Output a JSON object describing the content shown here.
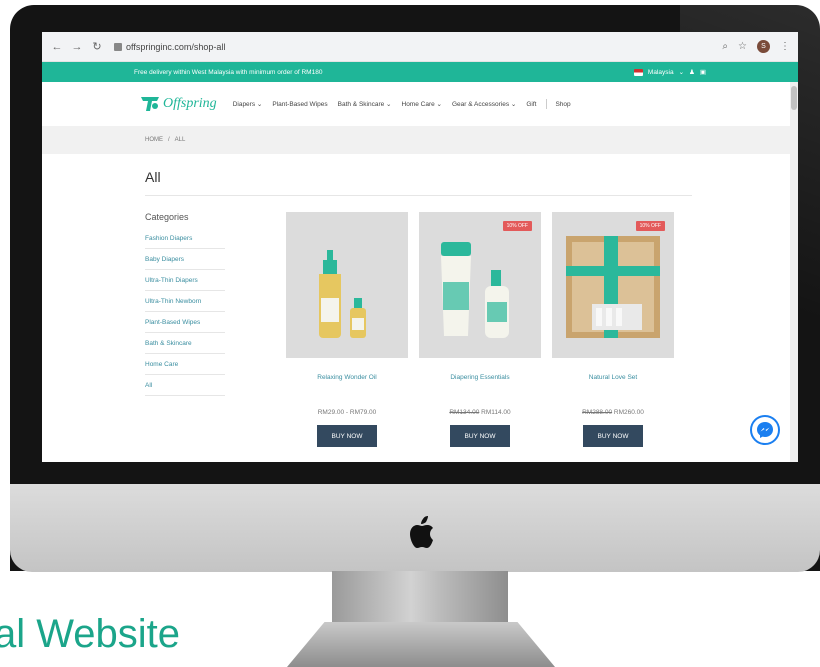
{
  "browser": {
    "url": "offspringinc.com/shop-all",
    "profile_initial": "S"
  },
  "promo": {
    "text": "Free delivery within West Malaysia with minimum order of RM180",
    "country": "Malaysia"
  },
  "logo": {
    "text": "Offspring"
  },
  "nav": {
    "items": [
      "Diapers ⌄",
      "Plant-Based Wipes",
      "Bath & Skincare ⌄",
      "Home Care ⌄",
      "Gear & Accessories ⌄",
      "Gift",
      "Shop"
    ]
  },
  "breadcrumb": {
    "home": "HOME",
    "separator": "/",
    "current": "ALL"
  },
  "page": {
    "title": "All"
  },
  "categories": {
    "heading": "Categories",
    "items": [
      "Fashion Diapers",
      "Baby Diapers",
      "Ultra-Thin Diapers",
      "Ultra-Thin Newborn",
      "Plant-Based Wipes",
      "Bath & Skincare",
      "Home Care",
      "All"
    ]
  },
  "products": [
    {
      "name": "Relaxing Wonder Oil",
      "price": "RM29.00 - RM79.00",
      "old_price": "",
      "badge": "",
      "button": "BUY NOW"
    },
    {
      "name": "Diapering Essentials",
      "price": "RM114.00",
      "old_price": "RM134.00",
      "badge": "10% OFF",
      "button": "BUY NOW"
    },
    {
      "name": "Natural Love Set",
      "price": "RM260.00",
      "old_price": "RM288.00",
      "badge": "10% OFF",
      "button": "BUY NOW"
    }
  ],
  "caption": "al Website",
  "colors": {
    "brand": "#1fb698",
    "button": "#33495f",
    "badge": "#e35a5a",
    "link": "#3a8ea0"
  }
}
